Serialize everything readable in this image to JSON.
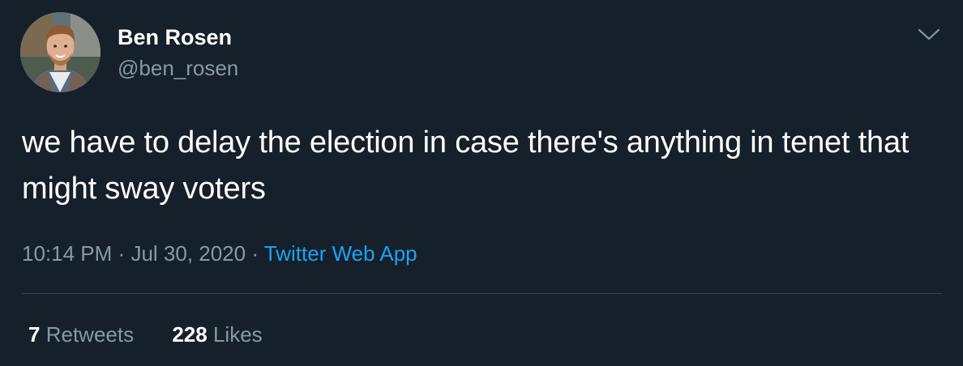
{
  "author": {
    "name": "Ben Rosen",
    "handle": "@ben_rosen"
  },
  "tweet": {
    "text": "we have to delay the election in case there's anything in tenet that might sway voters"
  },
  "meta": {
    "time": "10:14 PM",
    "separator": "·",
    "date": "Jul 30, 2020",
    "source": "Twitter Web App"
  },
  "stats": {
    "retweets_count": "7",
    "retweets_label": "Retweets",
    "likes_count": "228",
    "likes_label": "Likes"
  },
  "icons": {
    "menu": "chevron-down-icon"
  },
  "colors": {
    "background": "#15202b",
    "text_primary": "#ffffff",
    "text_secondary": "#8899a6",
    "link": "#1da1f2",
    "divider": "#38444d"
  }
}
